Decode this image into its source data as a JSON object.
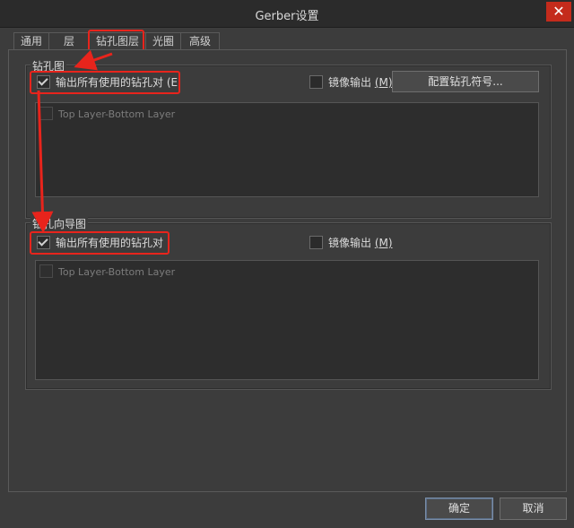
{
  "window": {
    "title": "Gerber设置",
    "close_glyph": "✕"
  },
  "tabs": [
    {
      "label": "通用"
    },
    {
      "label": "层"
    },
    {
      "label": "钻孔图层",
      "active": true
    },
    {
      "label": "光圈"
    },
    {
      "label": "高级"
    }
  ],
  "drill_drawing": {
    "title": "钻孔图",
    "output_all_pairs": {
      "label": "输出所有使用的钻孔对 (E",
      "checked": true
    },
    "mirror": {
      "label": "镜像输出 ",
      "accel": "(M)",
      "checked": false
    },
    "configure_button": "配置钻孔符号...",
    "layers": [
      {
        "label": "Top Layer-Bottom Layer",
        "checked": false,
        "enabled": false
      }
    ]
  },
  "drill_guide": {
    "title": "钻孔向导图",
    "output_all_pairs": {
      "label": "输出所有使用的钻孔对",
      "checked": true
    },
    "mirror": {
      "label": "镜像输出 ",
      "accel": "(M)",
      "checked": false
    },
    "layers": [
      {
        "label": "Top Layer-Bottom Layer",
        "checked": false,
        "enabled": false
      }
    ]
  },
  "footer": {
    "ok_label": "确定",
    "cancel_label": "取消"
  },
  "colors": {
    "highlight": "#e8241c",
    "background": "#3c3c3c",
    "close": "#c42b1c"
  }
}
